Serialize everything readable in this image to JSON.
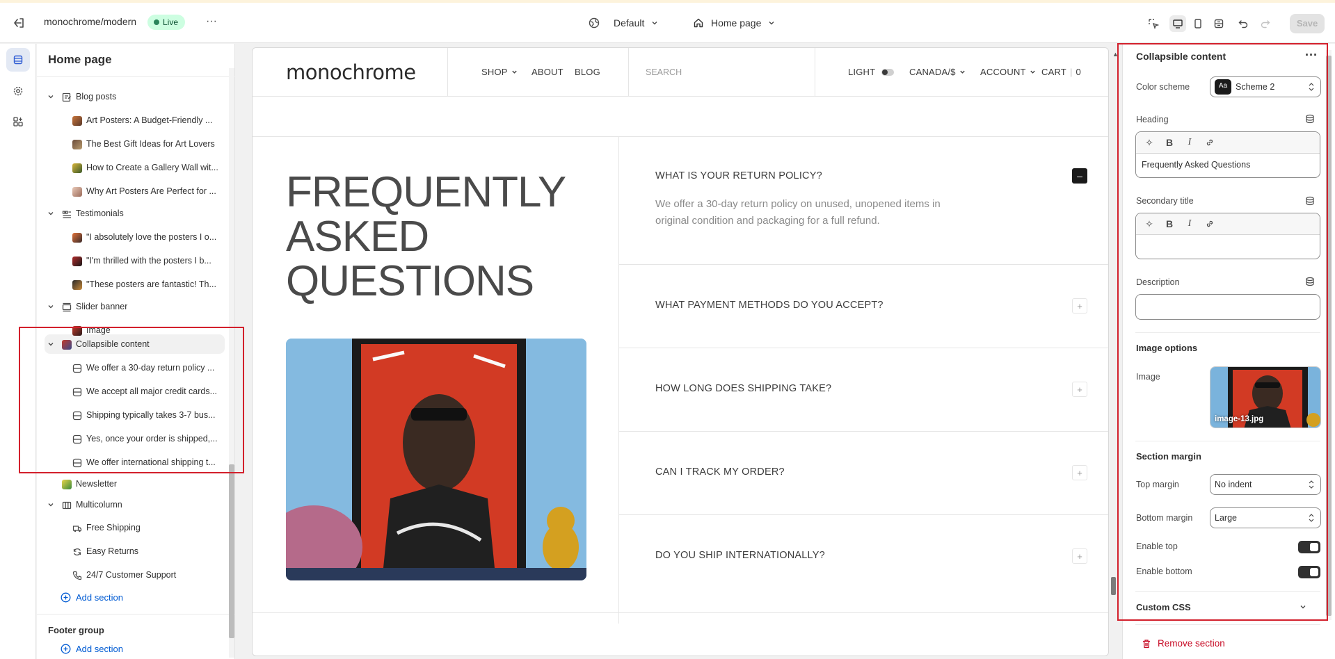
{
  "topbar": {
    "store_name": "monochrome/modern",
    "live_badge": "Live",
    "more_label": "···",
    "theme_label": "Default",
    "page_label": "Home page",
    "save_label": "Save"
  },
  "sidebar": {
    "title": "Home page",
    "groups": [
      {
        "label": "Blog posts",
        "items": [
          "Art Posters: A Budget-Friendly ...",
          "The Best Gift Ideas for Art Lovers",
          "How to Create a Gallery Wall wit...",
          "Why Art Posters Are Perfect for ..."
        ]
      },
      {
        "label": "Testimonials",
        "items": [
          "\"I absolutely love the posters I o...",
          "\"I'm thrilled with the posters I b...",
          "\"These posters are fantastic! Th..."
        ]
      },
      {
        "label": "Slider banner",
        "items": [
          "Image"
        ]
      },
      {
        "label": "Collapsible content",
        "items": [
          "We offer a 30-day return policy ...",
          "We accept all major credit cards...",
          "Shipping typically takes 3-7 bus...",
          "Yes, once your order is shipped,...",
          "We offer international shipping t..."
        ]
      },
      {
        "label": "Newsletter",
        "items": []
      },
      {
        "label": "Multicolumn",
        "items": [
          "Free Shipping",
          "Easy Returns",
          "24/7 Customer Support"
        ]
      }
    ],
    "add_section_label": "Add section",
    "footer_group_title": "Footer group",
    "footer_add_section_label": "Add section"
  },
  "preview": {
    "logo": "monochrome",
    "nav": {
      "shop": "SHOP",
      "about": "ABOUT",
      "blog": "BLOG",
      "search": "SEARCH",
      "light": "LIGHT",
      "region": "CANADA/$",
      "account": "ACCOUNT",
      "cart": "CART",
      "cart_count": "0"
    },
    "faq_title_lines": [
      "FREQUENTLY",
      "ASKED",
      "QUESTIONS"
    ],
    "faq": [
      {
        "question": "WHAT IS YOUR RETURN POLICY?",
        "answer": "We offer a 30-day return policy on unused, unopened items in original condition and packaging for a full refund.",
        "open": true
      },
      {
        "question": "WHAT PAYMENT METHODS DO YOU ACCEPT?",
        "open": false
      },
      {
        "question": "HOW LONG DOES SHIPPING TAKE?",
        "open": false
      },
      {
        "question": "CAN I TRACK MY ORDER?",
        "open": false
      },
      {
        "question": "DO YOU SHIP INTERNATIONALLY?",
        "open": false
      }
    ]
  },
  "panel": {
    "title": "Collapsible content",
    "color_scheme_label": "Color scheme",
    "color_scheme_value": "Scheme 2",
    "color_scheme_swatch": "Aa",
    "heading_label": "Heading",
    "heading_value": "Frequently Asked Questions",
    "secondary_title_label": "Secondary title",
    "secondary_title_value": "",
    "description_label": "Description",
    "description_value": "",
    "image_options_title": "Image options",
    "image_label": "Image",
    "image_filename": "image-13.jpg",
    "section_margin_title": "Section margin",
    "top_margin_label": "Top margin",
    "top_margin_value": "No indent",
    "bottom_margin_label": "Bottom margin",
    "bottom_margin_value": "Large",
    "enable_top_label": "Enable top",
    "enable_top_on": true,
    "enable_bottom_label": "Enable bottom",
    "enable_bottom_on": true,
    "custom_css_label": "Custom CSS",
    "remove_section_label": "Remove section"
  },
  "colors": {
    "live_badge_bg": "#cdfee1",
    "link_blue": "#005bd3",
    "danger_red": "#c70a24",
    "highlight_red": "#d3202c"
  }
}
